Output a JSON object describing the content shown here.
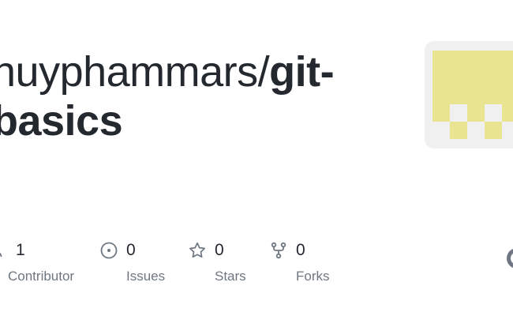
{
  "repo": {
    "owner": "huyphammars/",
    "name": "git-basics"
  },
  "stats": [
    {
      "value": "1",
      "label": "Contributor",
      "icon": "people-icon"
    },
    {
      "value": "0",
      "label": "Issues",
      "icon": "issue-icon"
    },
    {
      "value": "0",
      "label": "Stars",
      "icon": "star-icon"
    },
    {
      "value": "0",
      "label": "Forks",
      "icon": "fork-icon"
    }
  ],
  "colors": {
    "text": "#24292f",
    "muted": "#6e7781",
    "avatar_fill": "#e8e490",
    "avatar_bg": "#f0f0f0"
  }
}
